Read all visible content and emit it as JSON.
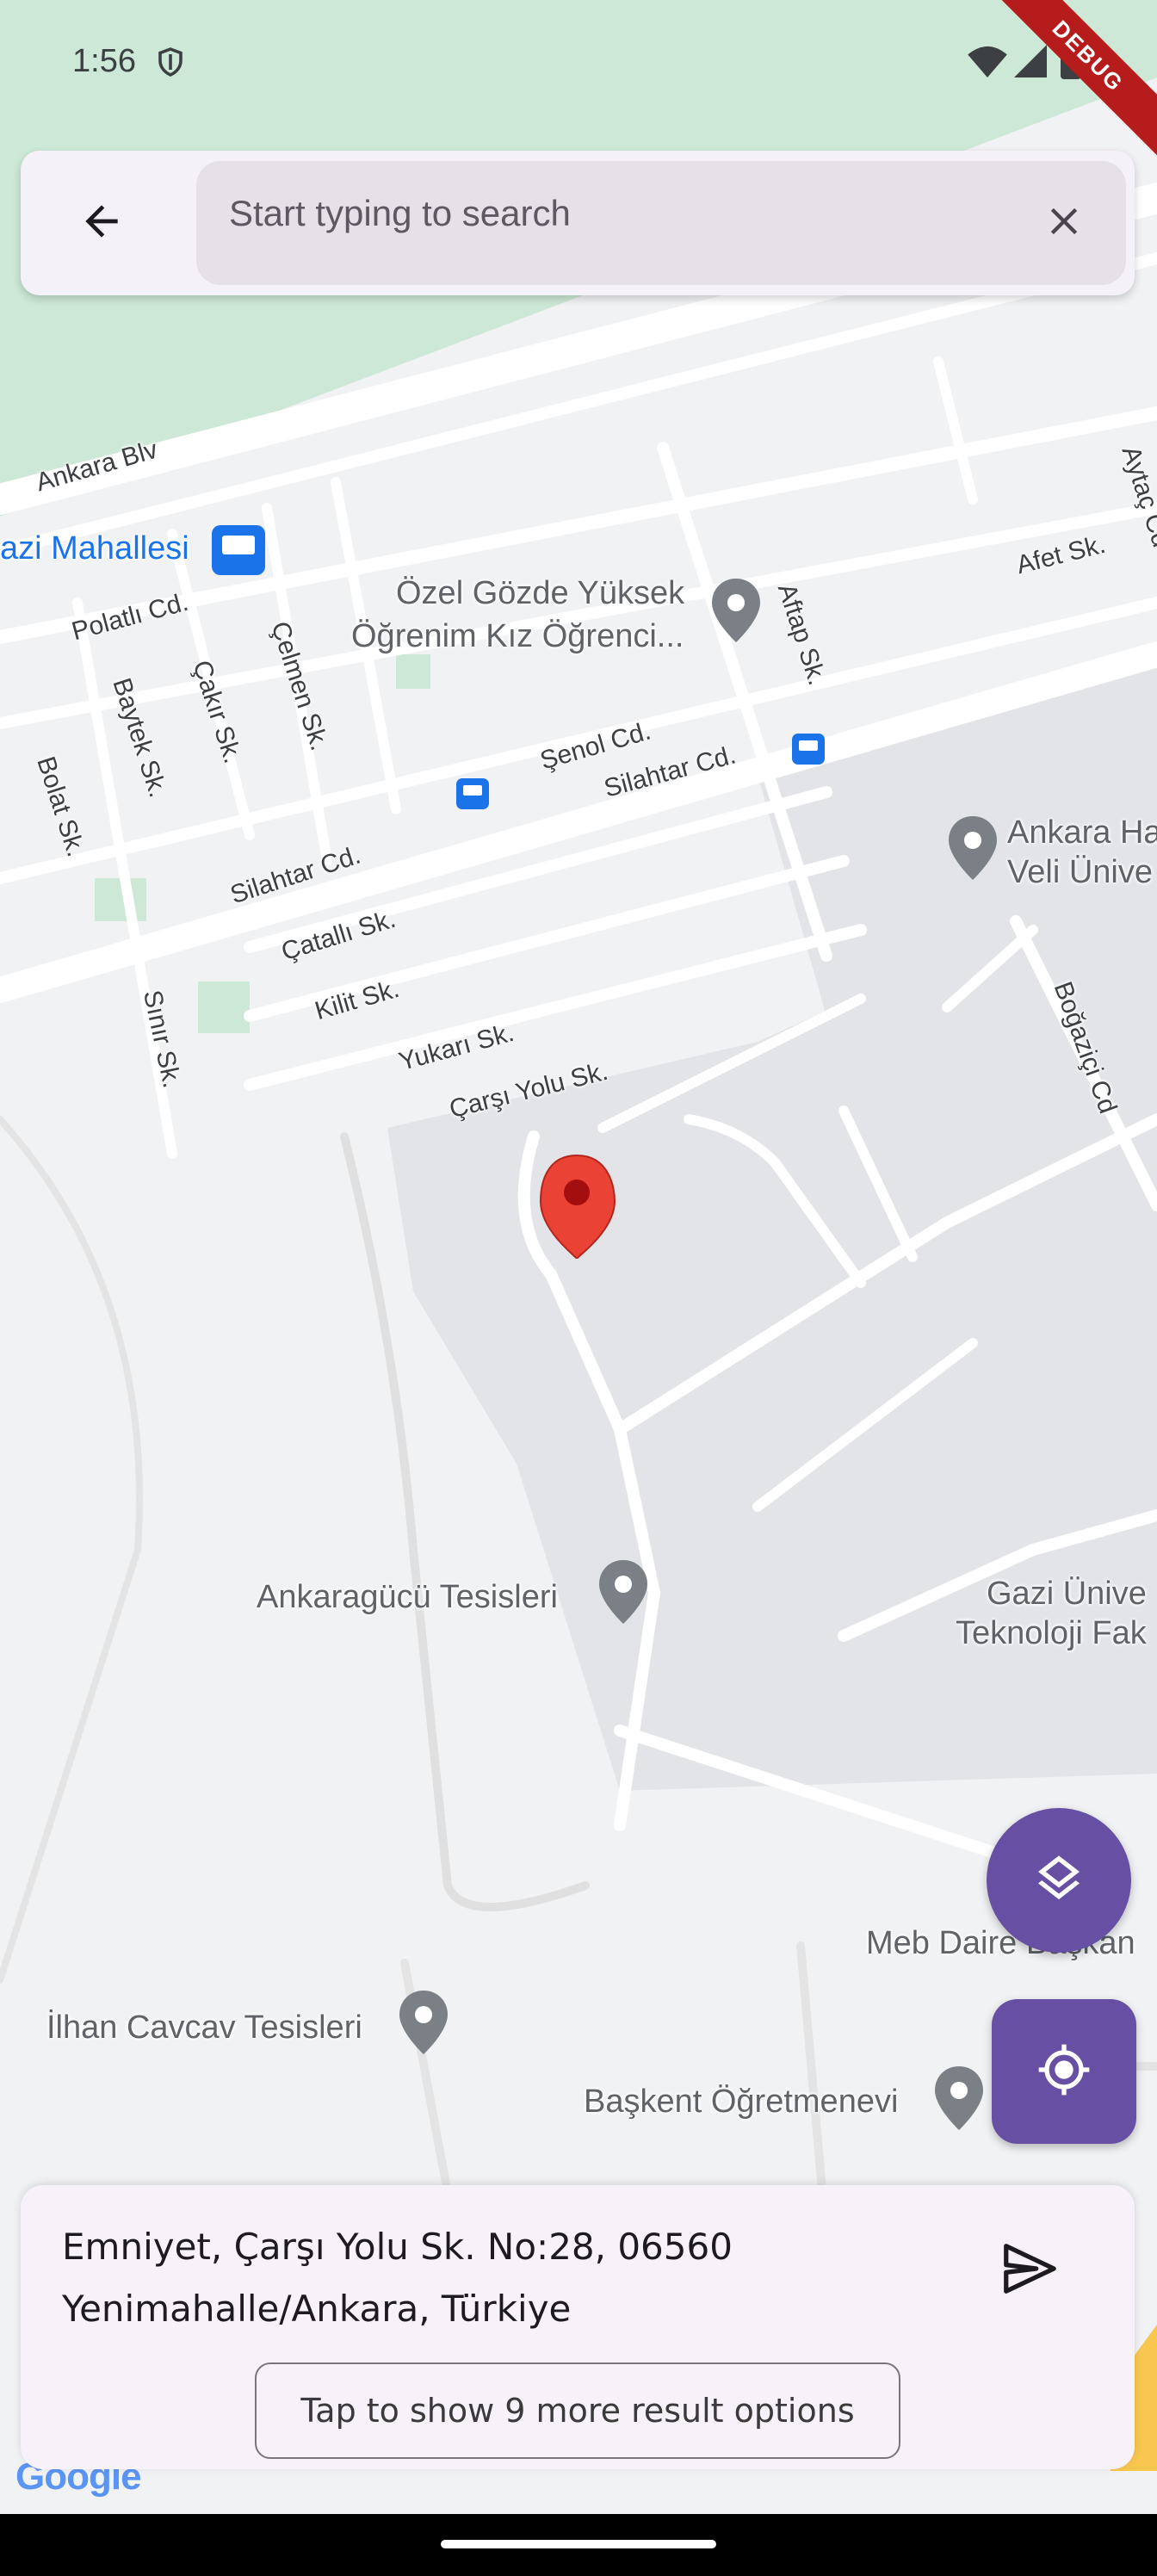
{
  "status_bar": {
    "time": "1:56",
    "debug_banner": "DEBUG",
    "icons": [
      "shield-icon",
      "wifi-icon",
      "signal-icon",
      "battery-icon"
    ]
  },
  "search": {
    "placeholder": "Start typing to search",
    "value": "",
    "back_icon": "arrow-left-icon",
    "clear_icon": "close-icon"
  },
  "map": {
    "provider_logo": "Google",
    "road_labels": {
      "ankara_blv": "Ankara Blv",
      "polatli": "Polatlı Cd.",
      "baytek": "Baytek Sk.",
      "cakir": "Çakır Sk.",
      "celmen": "Çelmen Sk.",
      "bolat": "Bolat Sk.",
      "senol": "Şenol Cd.",
      "silahtar1": "Silahtar Cd.",
      "silahtar2": "Silahtar Cd.",
      "aftap": "Aftap Sk.",
      "afet": "Afet Sk.",
      "aytac": "Aytaç Cd",
      "catalli": "Çatallı Sk.",
      "kilit": "Kilit Sk.",
      "sinir": "Sınır Sk.",
      "yukari": "Yukarı Sk.",
      "carsi": "Çarşı Yolu Sk.",
      "bogazici": "Boğaziçi Cd"
    },
    "poi_labels": {
      "mahalle": "azi Mahallesi",
      "ozel_gozde": "Özel Gözde Yüksek",
      "ozel_gozde_2": "Öğrenim Kız Öğrenci...",
      "ankara_hv_1": "Ankara Ha",
      "ankara_hv_2": "Veli Ünive",
      "ankaragucu": "Ankaragücü Tesisleri",
      "gazi_1": "Gazi Ünive",
      "gazi_2": "Teknoloji Fak",
      "meb": "Meb Daire Başkan",
      "ilhan": "İlhan Cavcav Tesisleri",
      "baskent": "Başkent Öğretmenevi"
    },
    "colors": {
      "park": "#cde8d6",
      "campus": "#e3e4e8",
      "road": "#ffffff",
      "background": "#f1f2f4",
      "marker": "#ea4335",
      "transit": "#1a73e8"
    }
  },
  "fabs": {
    "layers_icon": "layers-icon",
    "location_icon": "my-location-icon",
    "accent": "#6750a4"
  },
  "result": {
    "address_line1": "Emniyet, Çarşı Yolu Sk. No:28, 06560",
    "address_line2": "Yenimahalle/Ankara, Türkiye",
    "send_icon": "send-icon",
    "more_button": "Tap to show 9 more result options"
  }
}
